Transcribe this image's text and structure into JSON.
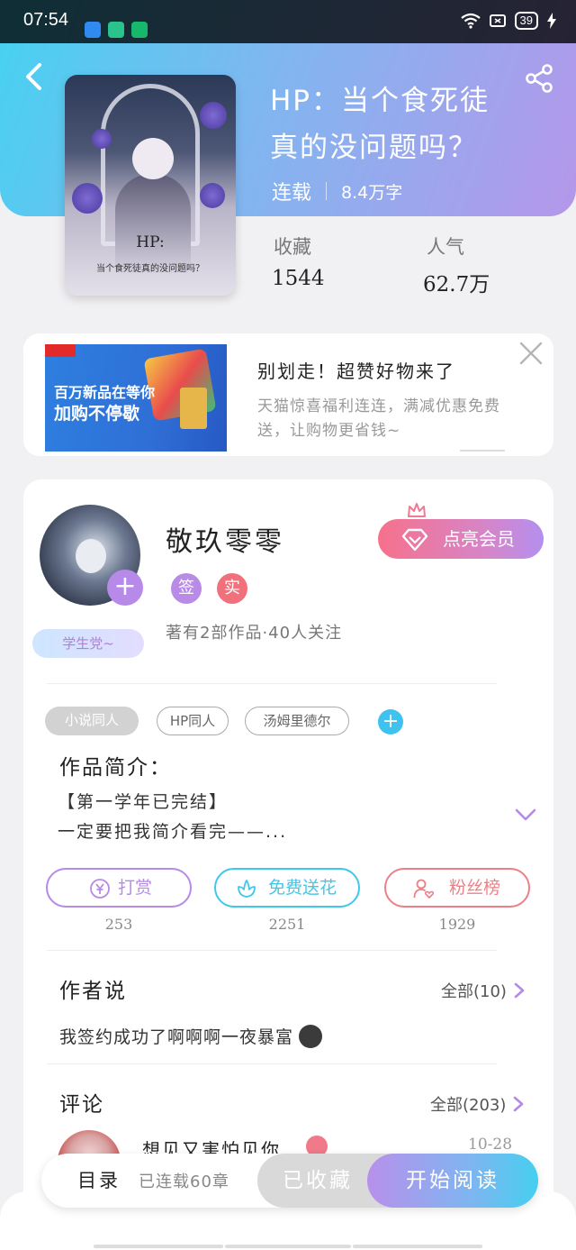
{
  "status_bar": {
    "time": "07:54",
    "battery": "39"
  },
  "book": {
    "title_line1": "HP：当个食死徒",
    "title_line2": "真的没问题吗？",
    "status": "连载",
    "word_count": "8.4万字",
    "cover_text_main": "HP:",
    "cover_text_sub": "当个食死徒真的没问题吗？",
    "stats": [
      {
        "label": "收藏",
        "value": "1544"
      },
      {
        "label": "人气",
        "value": "62.7万"
      }
    ]
  },
  "ad": {
    "image_line1": "百万新品在等你",
    "image_line2": "加购不停歇",
    "title": "别划走！超赞好物来了",
    "desc": "天猫惊喜福利连连，满减优惠免费送，让购物更省钱~"
  },
  "author": {
    "name": "敬玖零零",
    "tag_sign": "签",
    "tag_real": "实",
    "student_badge": "学生党~",
    "info": "著有2部作品·40人关注",
    "vip_label": "点亮会员"
  },
  "tags": [
    "小说同人",
    "HP同人",
    "汤姆里德尔"
  ],
  "intro": {
    "heading": "作品简介：",
    "line1": "【第一学年已完结】",
    "line2": "一定要把我简介看完——..."
  },
  "actions": [
    {
      "label": "打赏",
      "count": "253",
      "color": "#b68ae6"
    },
    {
      "label": "免费送花",
      "count": "2251",
      "color": "#3fc8ea"
    },
    {
      "label": "粉丝榜",
      "count": "1929",
      "color": "#ee7f86"
    }
  ],
  "author_says": {
    "heading": "作者说",
    "more": "全部(10)",
    "content": "我签约成功了啊啊啊一夜暴富"
  },
  "comments": {
    "heading": "评论",
    "more": "全部(203)",
    "first": {
      "name": "想见又害怕见你",
      "date": "10-28"
    }
  },
  "bottom_bar": {
    "toc": "目录",
    "toc_sub": "已连载60章",
    "saved": "已收藏",
    "read": "开始阅读"
  }
}
